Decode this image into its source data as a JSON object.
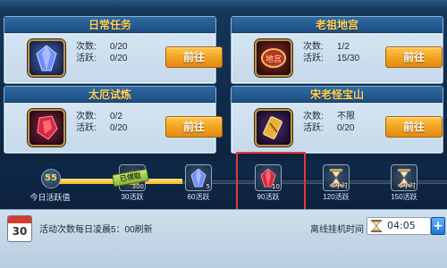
{
  "tasks": [
    {
      "title": "日常任务",
      "count_label": "次数:",
      "count_value": "0/20",
      "activity_label": "活跃:",
      "activity_value": "0/20",
      "button": "前往",
      "icon": "blue-crystal-icon"
    },
    {
      "title": "老祖地宫",
      "count_label": "次数:",
      "count_value": "1/2",
      "activity_label": "活跃:",
      "activity_value": "15/30",
      "button": "前往",
      "icon": "palace-gate-icon"
    },
    {
      "title": "太厄试炼",
      "count_label": "次数:",
      "count_value": "0/2",
      "activity_label": "活跃:",
      "activity_value": "0/20",
      "button": "前往",
      "icon": "red-crystal-icon"
    },
    {
      "title": "宋老怪宝山",
      "count_label": "次数:",
      "count_value": "不限",
      "activity_label": "活跃:",
      "activity_value": "0/20",
      "button": "前往",
      "icon": "treasure-scroll-icon"
    }
  ],
  "progress": {
    "score": "55",
    "score_label": "今日活跃值",
    "rewards": [
      {
        "label": "30活跃",
        "count": "300",
        "claimed": true,
        "claimed_text": "已领取",
        "icon": "gold-coins-icon"
      },
      {
        "label": "60活跃",
        "count": "5",
        "claimed": false,
        "icon": "blue-crystal-icon"
      },
      {
        "label": "90活跃",
        "count": "10",
        "claimed": false,
        "icon": "red-crystal-icon"
      },
      {
        "label": "120活跃",
        "count": "5小时",
        "claimed": false,
        "icon": "hourglass-icon"
      },
      {
        "label": "150活跃",
        "count": "5小时",
        "claimed": false,
        "icon": "hourglass-icon"
      }
    ]
  },
  "bottom": {
    "calendar_day": "30",
    "reset_text": "活动次数每日凌晨5：00刷新",
    "offline_label": "离线挂机时间",
    "offline_time": "04:05",
    "plus": "+"
  },
  "colors": {
    "title_gold": "#ffd35a",
    "button_orange": "#f2a11f",
    "highlight_red": "#e03a3a"
  }
}
